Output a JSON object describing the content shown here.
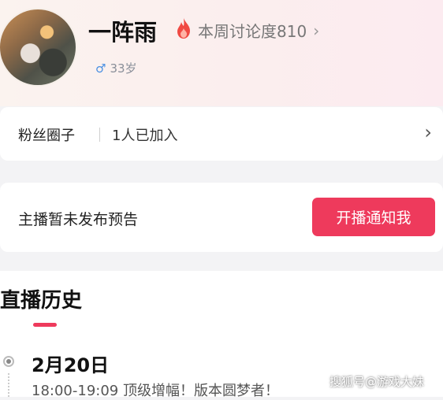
{
  "profile": {
    "name": "一阵雨",
    "heat_label": "本周讨论度810",
    "heat_icon": "flame-icon",
    "gender_symbol": "♂",
    "age": "33岁"
  },
  "fans_circle": {
    "title": "粉丝圈子",
    "count_text": "1人已加入"
  },
  "notice": {
    "text": "主播暂未发布预告",
    "button_label": "开播通知我"
  },
  "history": {
    "title": "直播历史",
    "entries": [
      {
        "date": "2月20日",
        "text": "18:00-19:09 顶级增幅！版本圆梦者！"
      }
    ]
  },
  "watermark": "搜狐号@游戏大妹",
  "colors": {
    "accent": "#ee3a5c",
    "gender": "#4a90e2",
    "flame": "#f04a43"
  }
}
